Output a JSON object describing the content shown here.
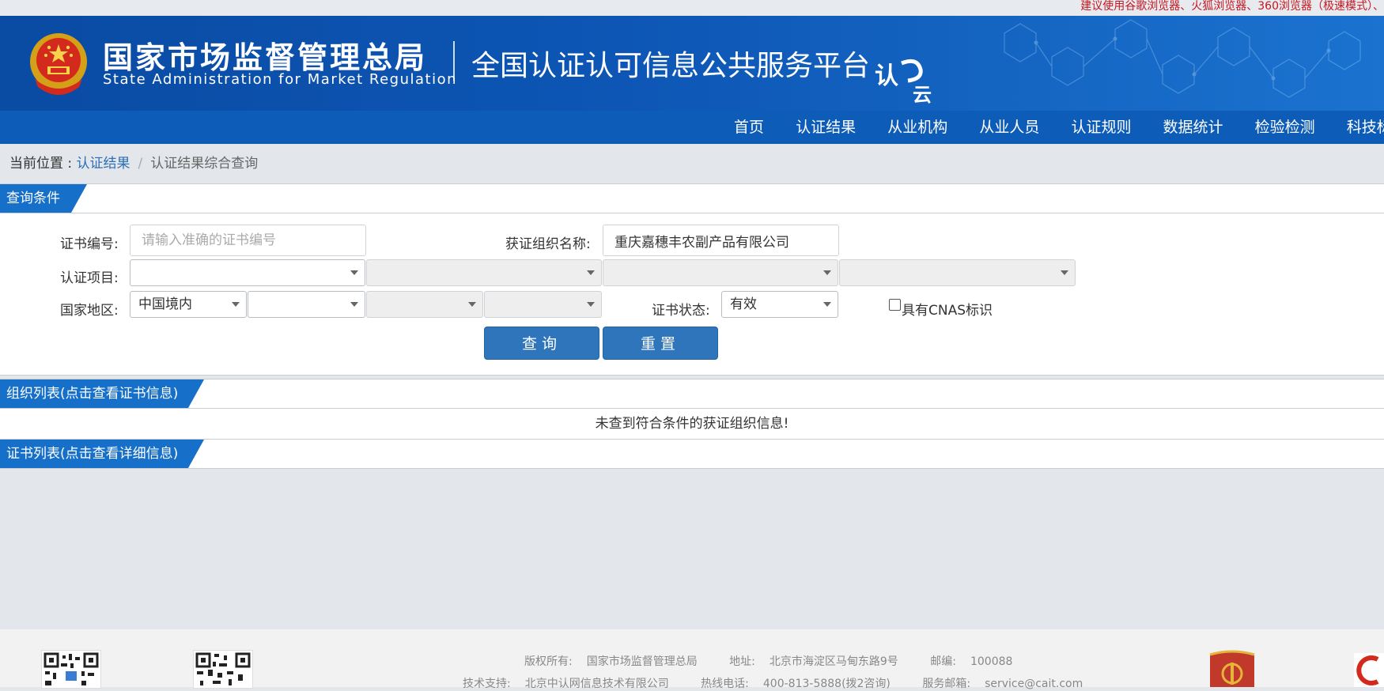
{
  "topbar": {
    "notice": "建议使用谷歌浏览器、火狐浏览器、360浏览器（极速模式）、"
  },
  "header": {
    "agency_cn": "国家市场监督管理总局",
    "agency_en": "State Administration for Market Regulation",
    "platform_title": "全国认证认可信息公共服务平台",
    "logo_text_a": "认",
    "logo_text_b": "云"
  },
  "nav": {
    "items": [
      "首页",
      "认证结果",
      "从业机构",
      "从业人员",
      "认证规则",
      "数据统计",
      "检验检测",
      "科技标"
    ]
  },
  "breadcrumb": {
    "prefix": "当前位置 : ",
    "link": "认证结果",
    "separator": "/",
    "current": "认证结果综合查询"
  },
  "query": {
    "section_title": "查询条件",
    "cert_no_label": "证书编号:",
    "cert_no_placeholder": "请输入准确的证书编号",
    "cert_no_value": "",
    "org_name_label": "获证组织名称:",
    "org_name_value": "重庆嘉穗丰农副产品有限公司",
    "project_label": "认证项目:",
    "project_selects": [
      "",
      "",
      "",
      ""
    ],
    "region_label": "国家地区:",
    "region_selects": [
      "中国境内",
      "",
      "",
      ""
    ],
    "status_label": "证书状态:",
    "status_value": "有效",
    "cnas_label": "具有CNAS标识",
    "cnas_checked": false,
    "search_button": "查询",
    "reset_button": "重置"
  },
  "org_list": {
    "section_title": "组织列表(点击查看证书信息)",
    "empty_message": "未查到符合条件的获证组织信息!"
  },
  "cert_list": {
    "section_title": "证书列表(点击查看详细信息)"
  },
  "footer": {
    "copyright_label": "版权所有:",
    "copyright_value": "国家市场监督管理总局",
    "address_label": "地址:",
    "address_value": "北京市海淀区马甸东路9号",
    "postcode_label": "邮编:",
    "postcode_value": "100088",
    "support_label": "技术支持:",
    "support_value": "北京中认网信息技术有限公司",
    "hotline_label": "热线电话:",
    "hotline_value": "400-813-5888(拨2咨询)",
    "email_label": "服务邮箱:",
    "email_value": "service@cait.com"
  },
  "colors": {
    "header_blue": "#0d56b5",
    "nav_blue": "#0d5cb8",
    "section_tab": "#1670c9",
    "button_blue": "#2e75bb",
    "notice_red": "#c8161e",
    "link_blue": "#2c6fb5"
  }
}
